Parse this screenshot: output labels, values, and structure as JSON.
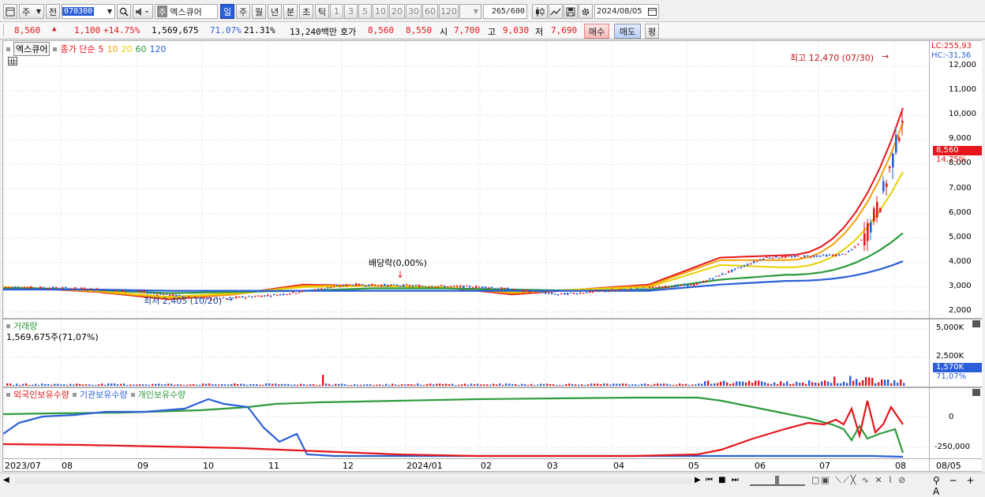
{
  "toolbar": {
    "period_type": "주",
    "prev_label": "전",
    "code": "070300",
    "stock_name": "엑스큐어",
    "stock_tag": "주",
    "periods": [
      "일",
      "주",
      "월",
      "년",
      "분",
      "초",
      "틱"
    ],
    "active_period": "일",
    "intervals": [
      "1",
      "3",
      "5",
      "10",
      "20",
      "30",
      "60",
      "120"
    ],
    "count": "265",
    "count_max": "/600",
    "date": "2024/08/05"
  },
  "quote": {
    "price": "8,560",
    "change": "1,100",
    "change_pct": "+14.75%",
    "volume": "1,569,675",
    "vol_ratio": "71.07%",
    "turnover_pct": "21.31%",
    "amount": "13,240백만",
    "ask_label": "호가",
    "ask": "8,560",
    "bid": "8,550",
    "open_label": "시",
    "open": "7,700",
    "high_label": "고",
    "high": "9,030",
    "low_label": "저",
    "low": "7,690",
    "buy_label": "매수",
    "sell_label": "매도",
    "avg_label": "평"
  },
  "price_panel": {
    "name": "엑스큐어",
    "legend_main": "종가 단순",
    "ma": [
      {
        "label": "5",
        "color": "#e4161b"
      },
      {
        "label": "10",
        "color": "#f6a00c"
      },
      {
        "label": "20",
        "color": "#e8d000"
      },
      {
        "label": "60",
        "color": "#2e9a3c"
      },
      {
        "label": "120",
        "color": "#2b5fd9"
      }
    ],
    "lc": "LC:255,93",
    "hc": "HC:-31,36",
    "yticks": [
      "12,000",
      "11,000",
      "10,000",
      "9,000",
      "8,000",
      "7,000",
      "6,000",
      "5,000",
      "4,000",
      "3,000",
      "2,000"
    ],
    "current_price": "8,560",
    "current_pct": "14,75%",
    "high_note": "최고 12,470 (07/30)",
    "low_note": "최저 2,405 (10/20)",
    "dividend_note": "배당락(0,00%)"
  },
  "volume_panel": {
    "title": "거래량",
    "value": "1,569,675주(71,07%)",
    "yticks": [
      "5,000K",
      "2,500K"
    ],
    "current": "1,570K",
    "current_pct": "71,07%"
  },
  "holding_panel": {
    "legend": [
      {
        "label": "외국인보유수량",
        "color": "#e4161b"
      },
      {
        "label": "기관보유수량",
        "color": "#2b5fd9"
      },
      {
        "label": "개인보유수량",
        "color": "#2e9a3c"
      }
    ],
    "yticks": [
      "0",
      "-250,000"
    ]
  },
  "x_axis": {
    "labels": [
      "2023/07",
      "08",
      "09",
      "10",
      "11",
      "12",
      "2024/01",
      "02",
      "03",
      "04",
      "05",
      "06",
      "07",
      "08"
    ],
    "right_label": "08/05"
  },
  "colors": {
    "up": "#e4161b",
    "down": "#2b5fd9",
    "accent": "#2b5fd9"
  },
  "chart_data": {
    "type": "line",
    "title": "",
    "x": [
      "2023/07",
      "08",
      "09",
      "10",
      "11",
      "12",
      "2024/01",
      "02",
      "03",
      "04",
      "05",
      "06",
      "07",
      "08"
    ],
    "ylim": [
      2000,
      12500
    ],
    "series": [
      {
        "name": "5",
        "values": [
          3000,
          2950,
          2800,
          2500,
          2700,
          3100,
          3050,
          3000,
          2700,
          2900,
          3100,
          4200,
          4300,
          10300
        ]
      },
      {
        "name": "10",
        "values": [
          3000,
          2960,
          2820,
          2550,
          2700,
          3050,
          3050,
          3000,
          2750,
          2900,
          3050,
          4100,
          4100,
          9700
        ]
      },
      {
        "name": "20",
        "values": [
          3000,
          2970,
          2850,
          2600,
          2750,
          3000,
          3050,
          3000,
          2800,
          2900,
          3000,
          3900,
          3800,
          7700
        ]
      },
      {
        "name": "60",
        "values": [
          2950,
          2950,
          2880,
          2750,
          2800,
          2850,
          2950,
          2950,
          2900,
          2850,
          2900,
          3300,
          3500,
          5200
        ]
      },
      {
        "name": "120",
        "values": [
          2900,
          2900,
          2900,
          2850,
          2850,
          2850,
          2850,
          2850,
          2850,
          2850,
          2850,
          3100,
          3250,
          4050
        ]
      }
    ]
  }
}
